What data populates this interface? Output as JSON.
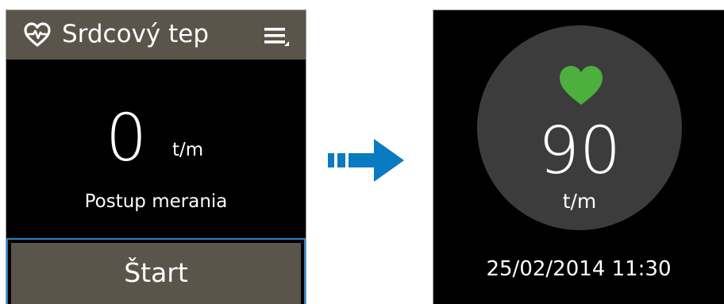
{
  "left_screen": {
    "header": {
      "title": "Srdcový tep",
      "icons": {
        "app": "heart-outline-icon",
        "menu": "menu-icon"
      },
      "background": "#5b544b"
    },
    "measurement": {
      "value": "0",
      "unit": "t/m",
      "status": "Postup merania"
    },
    "start_button": {
      "label": "Štart",
      "background": "#5b544b",
      "focus_color": "#2a86c6"
    }
  },
  "transition": {
    "icon": "arrow-right-icon",
    "color": "#0a7bc0"
  },
  "right_screen": {
    "result": {
      "value": "90",
      "unit": "t/m",
      "icon": "green-heart-icon",
      "heart_color": "#4caf3e",
      "dial_color": "#3c3c3c"
    },
    "timestamp": "25/02/2014 11:30"
  }
}
